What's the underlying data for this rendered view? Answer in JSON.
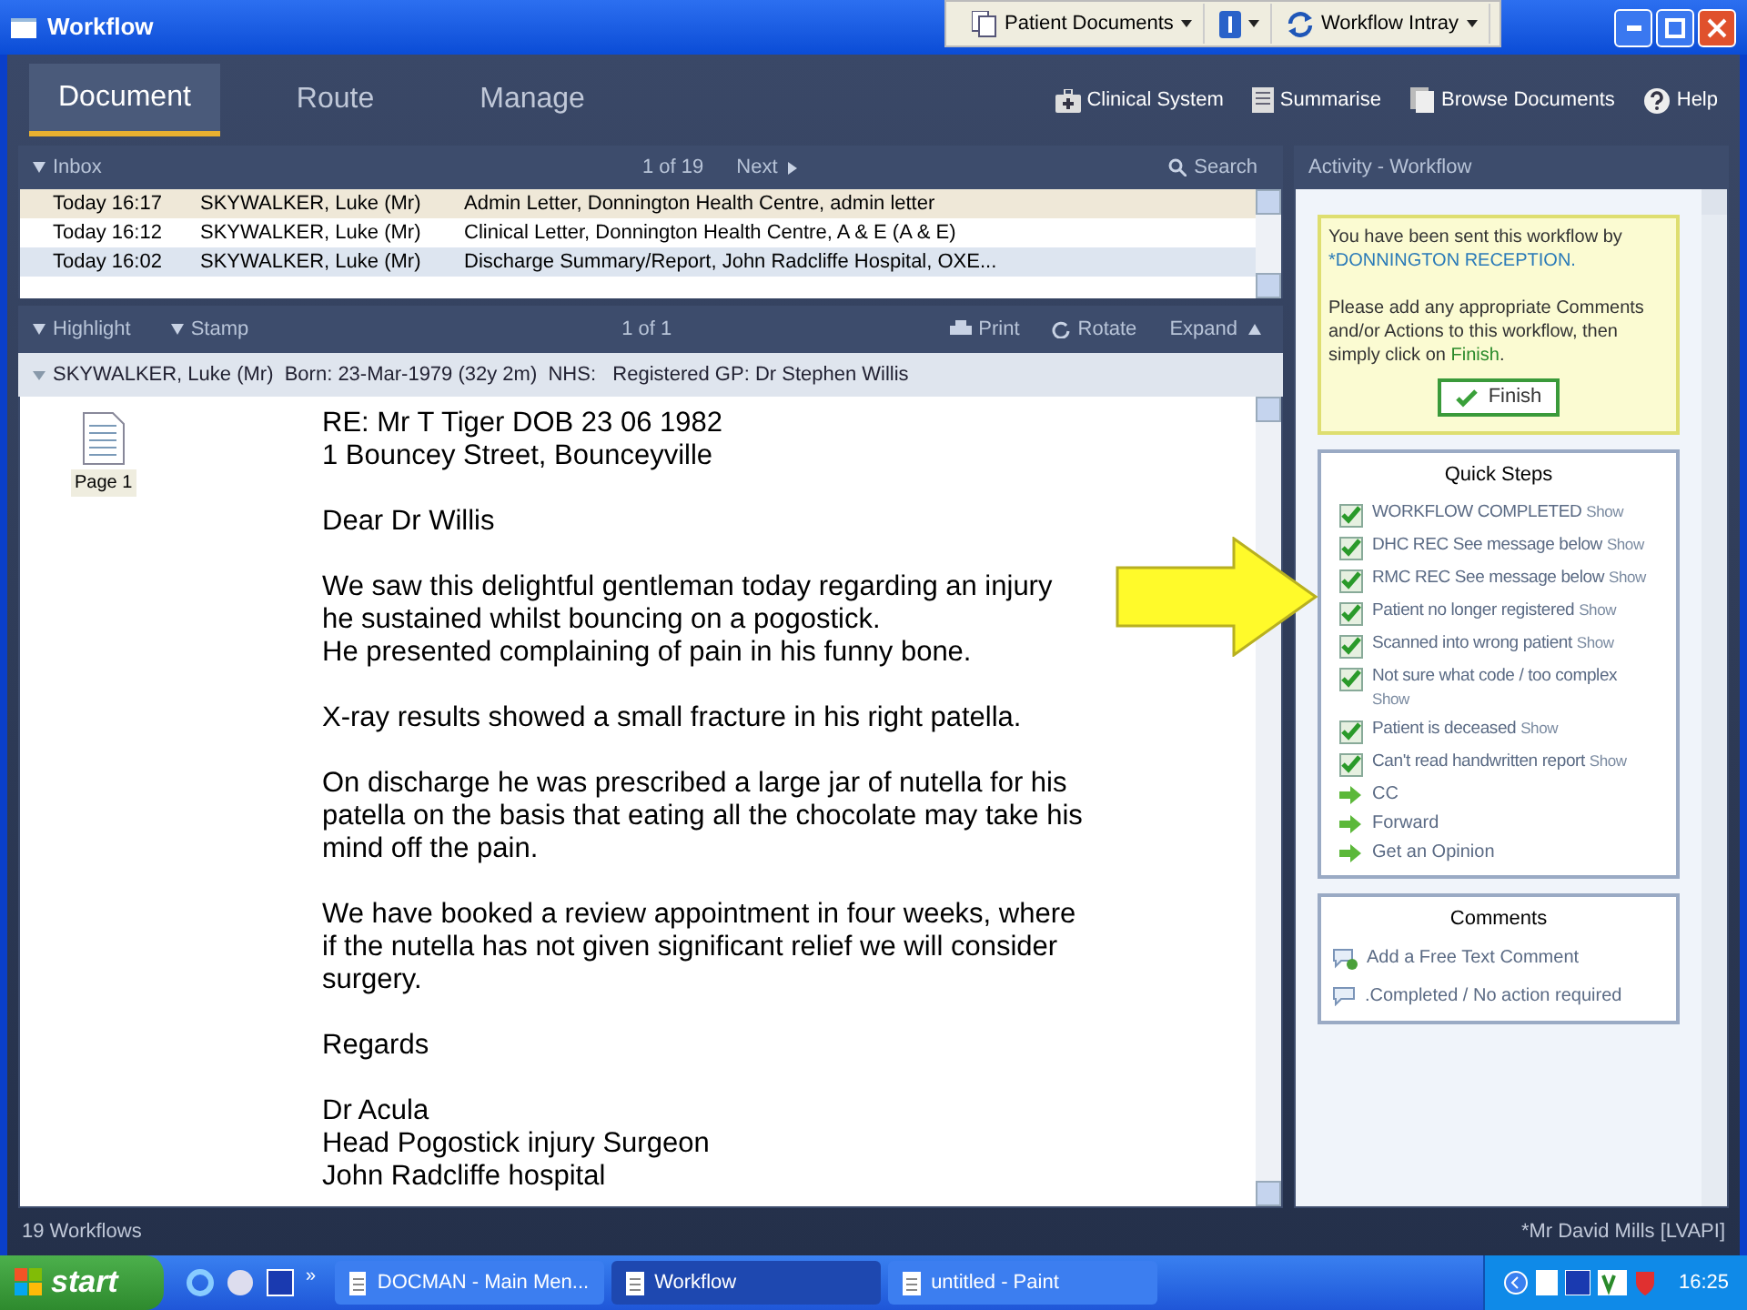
{
  "window": {
    "title": "Workflow"
  },
  "quick_toolbar": [
    {
      "label": "Patient Documents",
      "kind": "docs"
    },
    {
      "kind": "info"
    },
    {
      "label": "Workflow Intray",
      "kind": "refresh"
    }
  ],
  "tabs": [
    {
      "label": "Document",
      "selected": true
    },
    {
      "label": "Route",
      "selected": false
    },
    {
      "label": "Manage",
      "selected": false
    }
  ],
  "top_actions": [
    {
      "label": "Clinical System",
      "kind": "clinical"
    },
    {
      "label": "Summarise",
      "kind": "summarise"
    },
    {
      "label": "Browse Documents",
      "kind": "browse"
    },
    {
      "label": "Help",
      "kind": "help"
    }
  ],
  "inbox": {
    "title": "Inbox",
    "pager": "1 of 19",
    "next": "Next",
    "search": "Search",
    "rows": [
      {
        "time": "Today 16:17",
        "patient": "SKYWALKER, Luke (Mr)",
        "description": "Admin Letter, Donnington Health Centre, admin letter",
        "selected": true
      },
      {
        "time": "Today 16:12",
        "patient": "SKYWALKER, Luke (Mr)",
        "description": "Clinical Letter, Donnington Health Centre, A & E (A & E)",
        "selected": false
      },
      {
        "time": "Today 16:02",
        "patient": "SKYWALKER, Luke (Mr)",
        "description": "Discharge Summary/Report, John Radcliffe Hospital, OXE...",
        "selected": false
      }
    ]
  },
  "document_toolbar": {
    "highlight": "Highlight",
    "stamp": "Stamp",
    "pager": "1 of 1",
    "print": "Print",
    "rotate": "Rotate",
    "expand": "Expand"
  },
  "patient_banner": "SKYWALKER, Luke (Mr)  Born: 23-Mar-1979 (32y 2m)  NHS:   Registered GP: Dr Stephen Willis",
  "pages": [
    {
      "label": "Page 1"
    }
  ],
  "letter": [
    [
      "RE: Mr T Tiger DOB 23 06 1982",
      "1 Bouncey Street, Bounceyville"
    ],
    [
      "Dear Dr Willis"
    ],
    [
      "We saw this delightful gentleman today regarding an injury",
      "he sustained whilst bouncing on a pogostick.",
      "He presented complaining of pain in his funny bone."
    ],
    [
      "X-ray results showed a small fracture in his right patella."
    ],
    [
      "On discharge he was prescribed a large jar of nutella for his",
      "patella on the basis that eating all the chocolate may take his",
      "mind off the pain."
    ],
    [
      "We have booked a review appointment in four weeks, where",
      "if the nutella has not given significant relief we will consider",
      "surgery."
    ],
    [
      "Regards"
    ],
    [
      "Dr Acula",
      "Head Pogostick injury Surgeon",
      "John Radcliffe hospital"
    ]
  ],
  "activity": {
    "title": "Activity - Workflow",
    "message_1": "You have been sent this workflow by",
    "sender": "*DONNINGTON RECEPTION.",
    "message_2": "Please add any appropriate Comments and/or Actions to this workflow, then simply click on",
    "finish_link": "Finish",
    "finish_end": ".",
    "finish_button": "Finish"
  },
  "quick_steps": {
    "title": "Quick Steps",
    "items": [
      {
        "kind": "check",
        "label": "WORKFLOW COMPLETED",
        "show": "Show",
        "checked": true
      },
      {
        "kind": "check",
        "label": "DHC REC See message below",
        "show": "Show",
        "checked": true
      },
      {
        "kind": "check",
        "label": "RMC REC See message below",
        "show": "Show",
        "checked": true
      },
      {
        "kind": "check",
        "label": "Patient no longer registered",
        "show": "Show",
        "checked": true
      },
      {
        "kind": "check",
        "label": "Scanned into wrong patient",
        "show": "Show",
        "checked": true
      },
      {
        "kind": "check",
        "label": "Not sure what code / too complex",
        "show": "Show",
        "checked": true
      },
      {
        "kind": "check",
        "label": "Patient is deceased",
        "show": "Show",
        "checked": true
      },
      {
        "kind": "check",
        "label": "Can't read handwritten report",
        "show": "Show",
        "checked": true
      },
      {
        "kind": "action",
        "label": "CC"
      },
      {
        "kind": "action",
        "label": "Forward"
      },
      {
        "kind": "action",
        "label": "Get an Opinion"
      }
    ]
  },
  "comments": {
    "title": "Comments",
    "items": [
      {
        "kind": "add",
        "label": "Add a Free Text Comment"
      },
      {
        "kind": "preset",
        "label": ".Completed / No action required"
      }
    ]
  },
  "status_bar": {
    "left": "19 Workflows",
    "right": "*Mr David Mills [LVAPI]"
  },
  "taskbar": {
    "start": "start",
    "overflow": "»",
    "tasks": [
      {
        "label": "DOCMAN - Main Men...",
        "selected": false
      },
      {
        "label": "Workflow",
        "selected": true
      },
      {
        "label": "untitled - Paint",
        "selected": false
      }
    ],
    "clock": "16:25"
  }
}
